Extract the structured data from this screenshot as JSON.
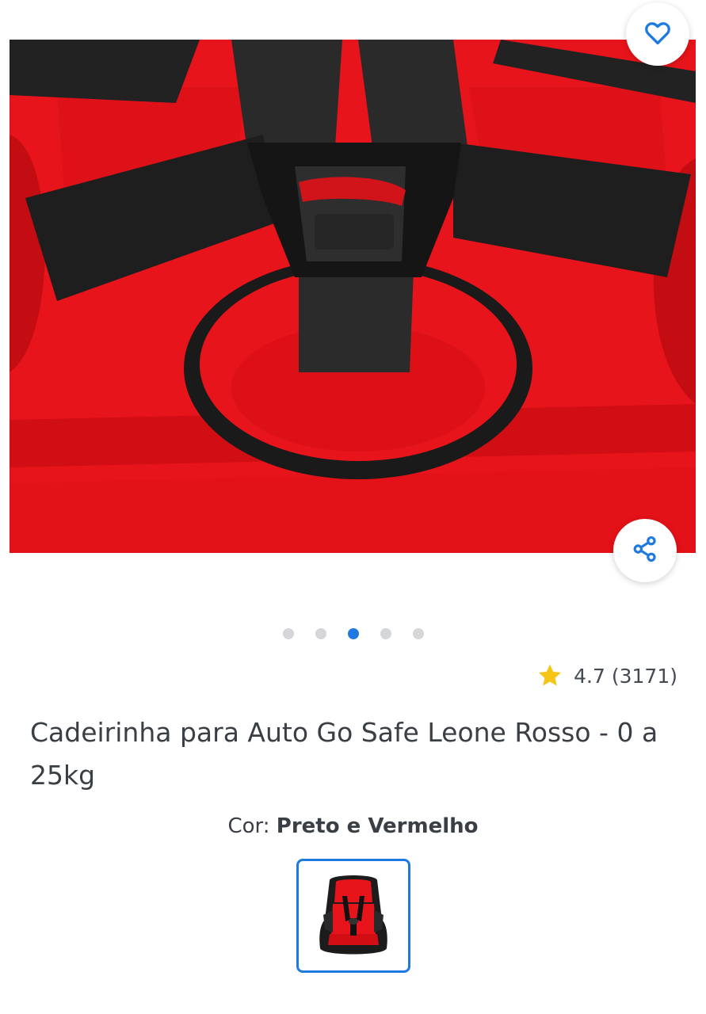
{
  "product": {
    "title": "Cadeirinha para Auto Go Safe Leone Rosso - 0 a 25kg",
    "rating": "4.7",
    "rating_count": "(3171)",
    "color_label": "Cor:",
    "color_value": "Preto e Vermelho"
  },
  "gallery": {
    "total_images": 5,
    "active_index": 2
  },
  "icons": {
    "favorite": "heart-icon",
    "share": "share-icon",
    "rating": "star-icon"
  },
  "colors": {
    "accent": "#1f7ae0",
    "star": "#f5c518",
    "seat_red": "#e8141b",
    "harness_black": "#1c1c1c",
    "dot_inactive": "#d4d6da"
  }
}
